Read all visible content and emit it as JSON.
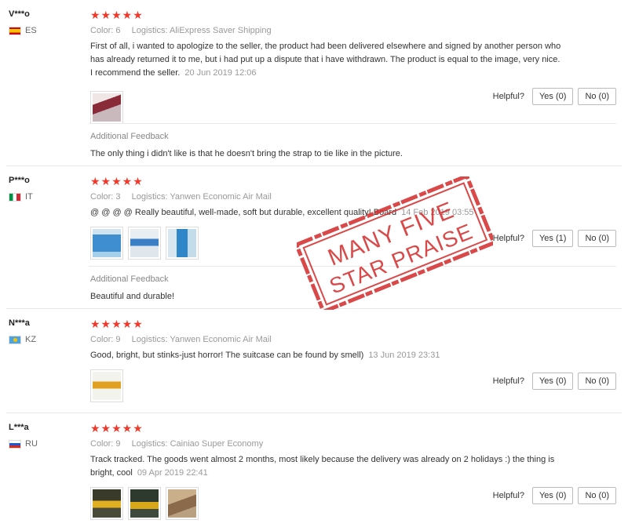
{
  "labels": {
    "color": "Color:",
    "logistics": "Logistics:",
    "helpful": "Helpful?",
    "additional_feedback": "Additional Feedback"
  },
  "reviews": [
    {
      "user": "V***o",
      "country": "ES",
      "stars": "★★★★★",
      "rating": 5,
      "color": "6",
      "logistics": "AliExpress Saver Shipping",
      "text": "First of all, i wanted to apologize to the seller, the product had been delivered elsewhere and signed by another person who has already returned it to me, but i had put up a dispute that i have withdrawn. The product is equal to the image, very nice. I recommend the seller.",
      "date": "20 Jun 2019 12:06",
      "yes": "Yes (0)",
      "no": "No (0)",
      "additional": "The only thing i didn't like is that he doesn't bring the strap to tie like in the picture."
    },
    {
      "user": "P***o",
      "country": "IT",
      "stars": "★★★★★",
      "rating": 5,
      "color": "3",
      "logistics": "Yanwen Economic Air Mail",
      "text": "@ @ @ @ Really beautiful, well-made, soft but durable, excellent quality! Board",
      "date": "14 Feb 2019 03:55",
      "yes": "Yes (1)",
      "no": "No (0)",
      "additional": "Beautiful and durable!"
    },
    {
      "user": "N***a",
      "country": "KZ",
      "stars": "★★★★★",
      "rating": 5,
      "color": "9",
      "logistics": "Yanwen Economic Air Mail",
      "text": "Good, bright, but stinks-just horror! The suitcase can be found by smell)",
      "date": "13 Jun 2019 23:31",
      "yes": "Yes (0)",
      "no": "No (0)"
    },
    {
      "user": "L***a",
      "country": "RU",
      "stars": "★★★★★",
      "rating": 5,
      "color": "9",
      "logistics": "Cainiao Super Economy",
      "text": "Track tracked. The goods went almost 2 months, most likely because the delivery was already on 2 holidays :) the thing is bright, cool",
      "date": "09 Apr 2019 22:41",
      "yes": "Yes (0)",
      "no": "No (0)"
    }
  ],
  "stamp": {
    "line1": "MANY FIVE",
    "line2": "STAR PRAISE",
    "color": "#d42a2a"
  }
}
